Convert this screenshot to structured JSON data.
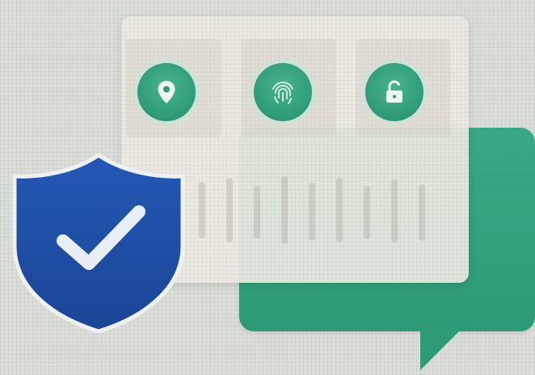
{
  "colors": {
    "background": "#dcded9",
    "card": "#ecebe4",
    "accent_green": "#2e9a78",
    "shield_blue": "#1f4fa8",
    "check": "#e8eef7"
  },
  "feature_icons": [
    {
      "name": "location-pin-icon"
    },
    {
      "name": "fingerprint-icon"
    },
    {
      "name": "unlocked-padlock-icon"
    }
  ],
  "badge": {
    "name": "shield-check-icon"
  }
}
